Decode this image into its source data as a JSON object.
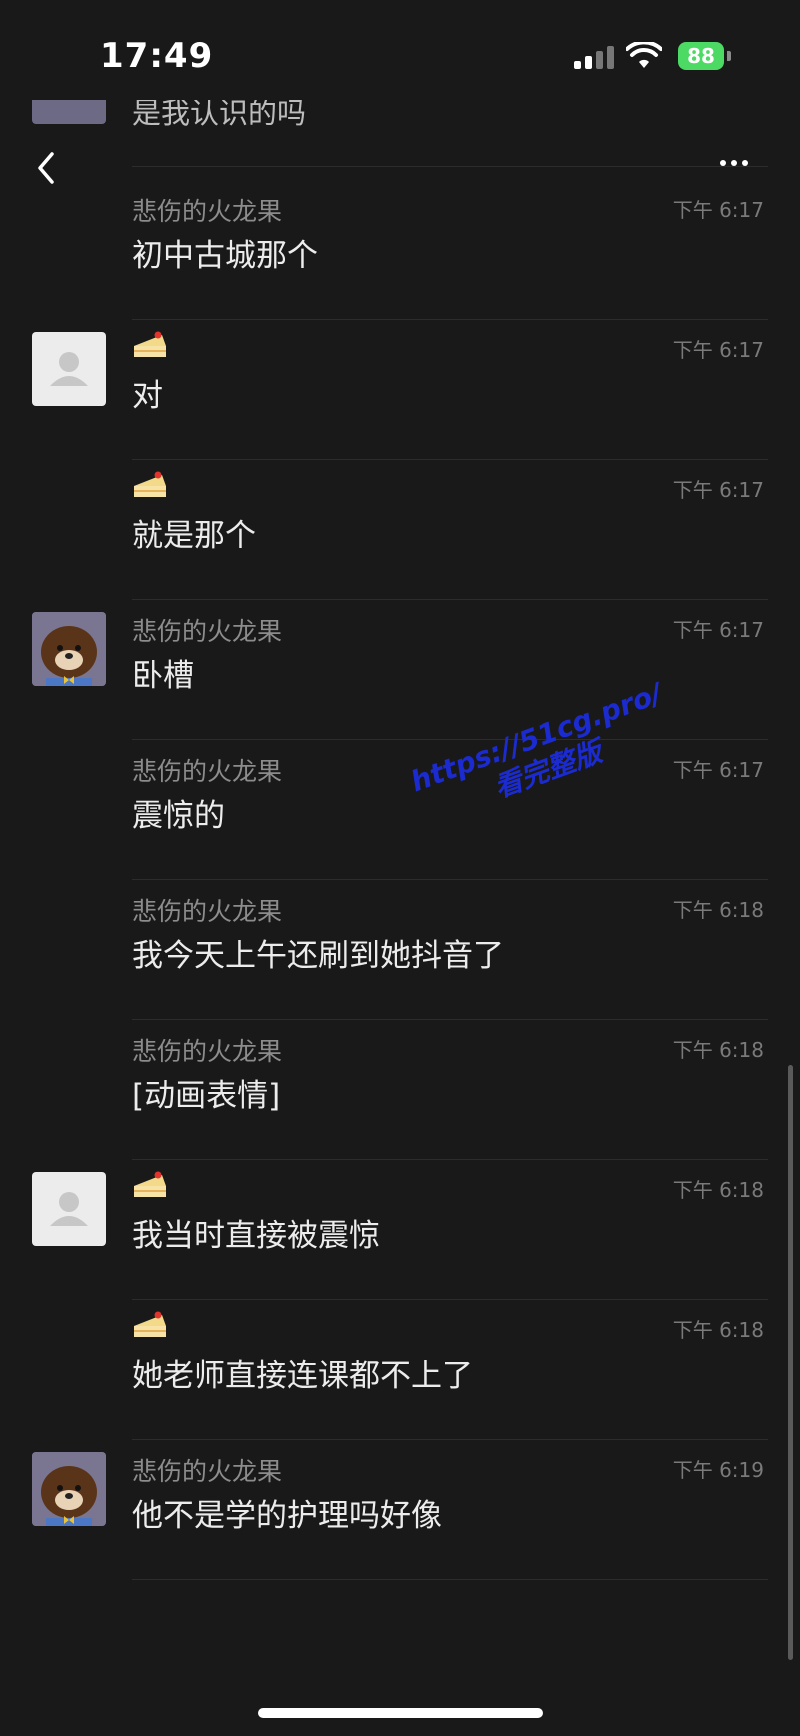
{
  "status_bar": {
    "time": "17:49",
    "battery": "88",
    "icons": [
      "cellular-signal-icon",
      "wifi-icon",
      "battery-charging-icon"
    ]
  },
  "header": {
    "partial_previous_message": "是我认识的吗",
    "icons": [
      "back-chevron-icon",
      "more-dots-icon"
    ]
  },
  "messages": [
    {
      "sender": "悲伤的火龙果",
      "avatar": "none",
      "time": "下午 6:17",
      "text": "初中古城那个"
    },
    {
      "sender": "",
      "avatar": "default-user",
      "time": "下午 6:17",
      "text": "对",
      "nickname_icon": "cake-emoji-icon"
    },
    {
      "sender": "",
      "avatar": "none",
      "time": "下午 6:17",
      "text": "就是那个",
      "nickname_icon": "cake-emoji-icon"
    },
    {
      "sender": "悲伤的火龙果",
      "avatar": "bear",
      "time": "下午 6:17",
      "text": "卧槽"
    },
    {
      "sender": "悲伤的火龙果",
      "avatar": "none",
      "time": "下午 6:17",
      "text": "震惊的"
    },
    {
      "sender": "悲伤的火龙果",
      "avatar": "none",
      "time": "下午 6:18",
      "text": "我今天上午还刷到她抖音了"
    },
    {
      "sender": "悲伤的火龙果",
      "avatar": "none",
      "time": "下午 6:18",
      "text": "[动画表情]"
    },
    {
      "sender": "",
      "avatar": "default-user",
      "time": "下午 6:18",
      "text": "我当时直接被震惊",
      "nickname_icon": "cake-emoji-icon"
    },
    {
      "sender": "",
      "avatar": "none",
      "time": "下午 6:18",
      "text": "她老师直接连课都不上了",
      "nickname_icon": "cake-emoji-icon"
    },
    {
      "sender": "悲伤的火龙果",
      "avatar": "bear",
      "time": "下午 6:19",
      "text": "他不是学的护理吗好像"
    }
  ],
  "watermark": {
    "line1": "https://51cg.pro/",
    "line2": "看完整版",
    "color": "#1b2bd0"
  }
}
